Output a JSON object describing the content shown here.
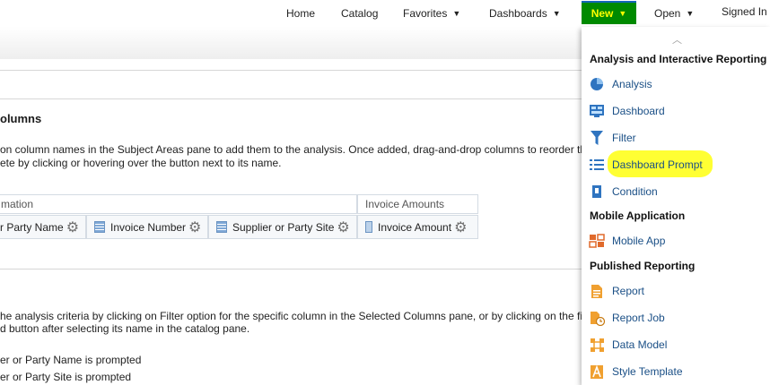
{
  "header": {
    "nav": [
      "Home",
      "Catalog",
      "Favorites",
      "Dashboards"
    ],
    "new_label": "New",
    "open_label": "Open",
    "signed_in": "Signed In"
  },
  "main": {
    "section_title": "olumns",
    "instructions": [
      "on column names in the Subject Areas pane to add them to the analysis. Once added, drag-and-drop columns to reorder th",
      "ete by clicking or hovering over the button next to its name."
    ],
    "groups": [
      "mation",
      "Invoice Amounts"
    ],
    "columns": [
      "r Party Name",
      "Invoice Number",
      "Supplier or Party Site",
      "Invoice Amount"
    ],
    "filter_instructions": [
      "he analysis criteria by clicking on Filter option for the specific column in the Selected Columns pane, or by clicking on the fil",
      "d button after selecting its name in the catalog pane."
    ],
    "filters": [
      "er or Party Name is prompted",
      "er or Party Site is prompted"
    ]
  },
  "menu": {
    "sections": [
      {
        "title": "Analysis and Interactive Reporting",
        "items": [
          {
            "label": "Analysis",
            "icon": "analysis-icon"
          },
          {
            "label": "Dashboard",
            "icon": "dashboard-icon"
          },
          {
            "label": "Filter",
            "icon": "filter-icon"
          },
          {
            "label": "Dashboard Prompt",
            "icon": "dashboard-prompt-icon"
          },
          {
            "label": "Condition",
            "icon": "condition-icon"
          }
        ]
      },
      {
        "title": "Mobile Application",
        "items": [
          {
            "label": "Mobile App",
            "icon": "mobile-app-icon"
          }
        ]
      },
      {
        "title": "Published Reporting",
        "items": [
          {
            "label": "Report",
            "icon": "report-icon"
          },
          {
            "label": "Report Job",
            "icon": "report-job-icon"
          },
          {
            "label": "Data Model",
            "icon": "data-model-icon"
          },
          {
            "label": "Style Template",
            "icon": "style-template-icon"
          }
        ]
      }
    ]
  },
  "colors": {
    "new_bg": "#008a00",
    "new_text": "#ffff00",
    "highlight": "#ffff33",
    "link": "#1a4f86"
  }
}
